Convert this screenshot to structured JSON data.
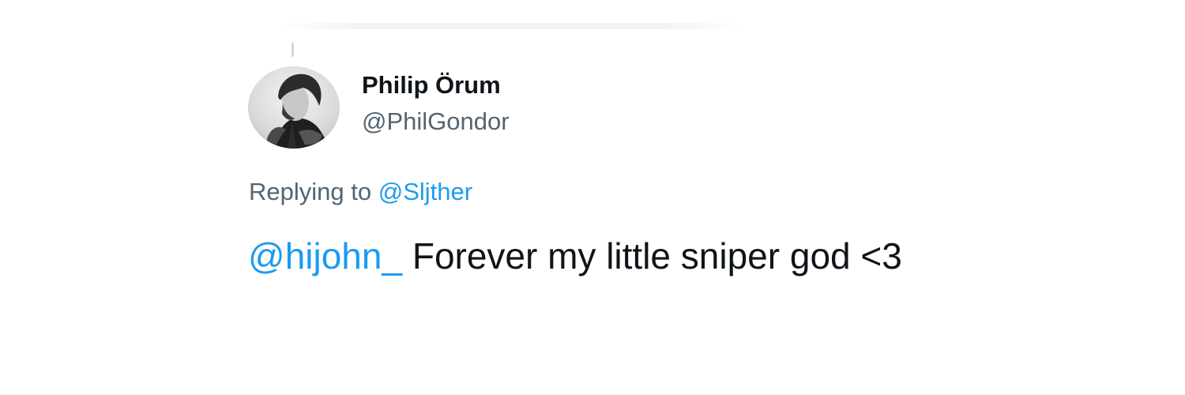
{
  "tweet": {
    "author": {
      "display_name": "Philip Örum",
      "handle": "@PhilGondor",
      "avatar": "profile-photo"
    },
    "reply_context": {
      "prefix": "Replying to",
      "mention": "@Sljther"
    },
    "body": {
      "mention": "@hijohn_",
      "text": "Forever my little sniper god <3"
    }
  },
  "colors": {
    "mention_blue": "#1d9bf0",
    "secondary_text": "#536471",
    "primary_text": "#0f1419"
  }
}
